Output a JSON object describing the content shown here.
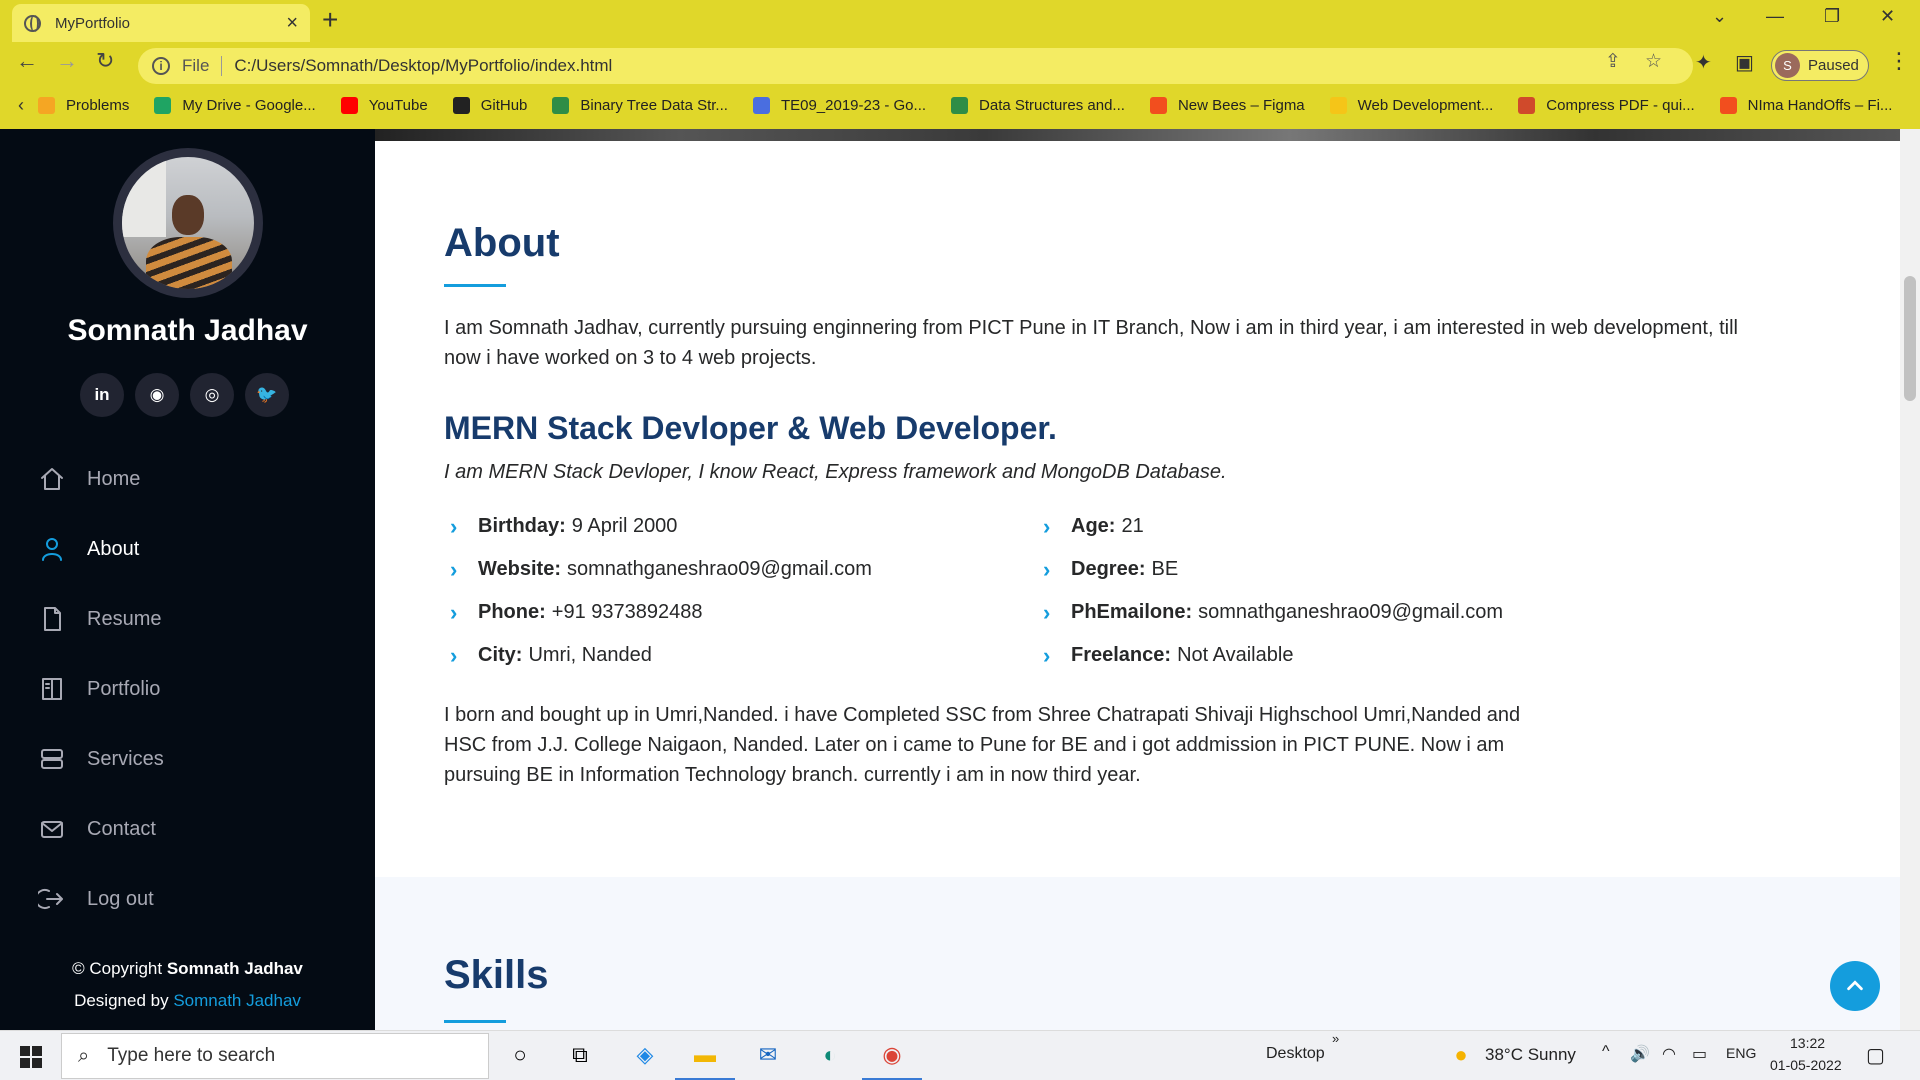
{
  "browser": {
    "tab_title": "MyPortfolio",
    "tab_close": "×",
    "new_tab": "+",
    "address_scheme": "File",
    "address_url": "C:/Users/Somnath/Desktop/MyPortfolio/index.html",
    "profile_initial": "S",
    "profile_label": "Paused",
    "bookmarks": [
      {
        "label": "Problems",
        "color": "#f5a623"
      },
      {
        "label": "My Drive - Google...",
        "color": "#1fa463"
      },
      {
        "label": "YouTube",
        "color": "#ff0000"
      },
      {
        "label": "GitHub",
        "color": "#222222"
      },
      {
        "label": "Binary Tree Data Str...",
        "color": "#2f8d46"
      },
      {
        "label": "TE09_2019-23 - Go...",
        "color": "#4a6ee0"
      },
      {
        "label": "Data Structures and...",
        "color": "#2f8d46"
      },
      {
        "label": "New Bees – Figma",
        "color": "#f24e1e"
      },
      {
        "label": "Web Development...",
        "color": "#f5c518"
      },
      {
        "label": "Compress PDF - qui...",
        "color": "#d04a2b"
      },
      {
        "label": "NIma HandOffs – Fi...",
        "color": "#f24e1e"
      }
    ]
  },
  "sidebar": {
    "name": "Somnath Jadhav",
    "socials": [
      "linkedin-icon",
      "github-icon",
      "instagram-icon",
      "twitter-icon"
    ],
    "social_glyphs": [
      "in",
      "◉",
      "◎",
      "🐦"
    ],
    "nav": [
      {
        "label": "Home",
        "icon": "home-icon",
        "active": false
      },
      {
        "label": "About",
        "icon": "user-icon",
        "active": true
      },
      {
        "label": "Resume",
        "icon": "file-icon",
        "active": false
      },
      {
        "label": "Portfolio",
        "icon": "book-icon",
        "active": false
      },
      {
        "label": "Services",
        "icon": "server-icon",
        "active": false
      },
      {
        "label": "Contact",
        "icon": "envelope-icon",
        "active": false
      },
      {
        "label": "Log out",
        "icon": "logout-icon",
        "active": false
      }
    ],
    "footer": {
      "copyright_prefix": "© Copyright",
      "copyright_name": "Somnath Jadhav",
      "designed_prefix": "Designed by",
      "designed_link": "Somnath Jadhav"
    }
  },
  "about": {
    "title": "About",
    "intro_line1": "I am Somnath Jadhav, currently pursuing enginnering from PICT Pune in IT Branch, Now i am in third year, i am interested in web development, till",
    "intro_line2": "now i have worked on 3 to 4 web projects.",
    "role": "MERN Stack Devloper & Web Developer.",
    "role_sub": "I am MERN Stack Devloper, I know React, Express framework and MongoDB Database.",
    "left_info": [
      {
        "label": "Birthday:",
        "value": "9 April 2000"
      },
      {
        "label": "Website:",
        "value": "somnathganeshrao09@gmail.com"
      },
      {
        "label": "Phone:",
        "value": "+91 9373892488"
      },
      {
        "label": "City:",
        "value": "Umri, Nanded"
      }
    ],
    "right_info": [
      {
        "label": "Age:",
        "value": "21"
      },
      {
        "label": "Degree:",
        "value": "BE"
      },
      {
        "label": "PhEmailone:",
        "value": "somnathganeshrao09@gmail.com"
      },
      {
        "label": "Freelance:",
        "value": "Not Available"
      }
    ],
    "bio_line1": "I born and bought up in Umri,Nanded. i have Completed SSC from Shree Chatrapati Shivaji Highschool Umri,Nanded and",
    "bio_line2": "HSC from J.J. College Naigaon, Nanded. Later on i came to Pune for BE and i got addmission in PICT PUNE. Now i am",
    "bio_line3": "pursuing BE in Information Technology branch. currently i am in now third year."
  },
  "skills": {
    "title": "Skills"
  },
  "taskbar": {
    "search_placeholder": "Type here to search",
    "desktop_label": "Desktop",
    "weather": "38°C  Sunny",
    "language": "ENG",
    "time": "13:22",
    "date": "01-05-2022"
  },
  "colors": {
    "accent": "#149ddd",
    "heading": "#173b6c",
    "sidebar_bg": "#040b14",
    "chrome_bg": "#e0d72a"
  }
}
